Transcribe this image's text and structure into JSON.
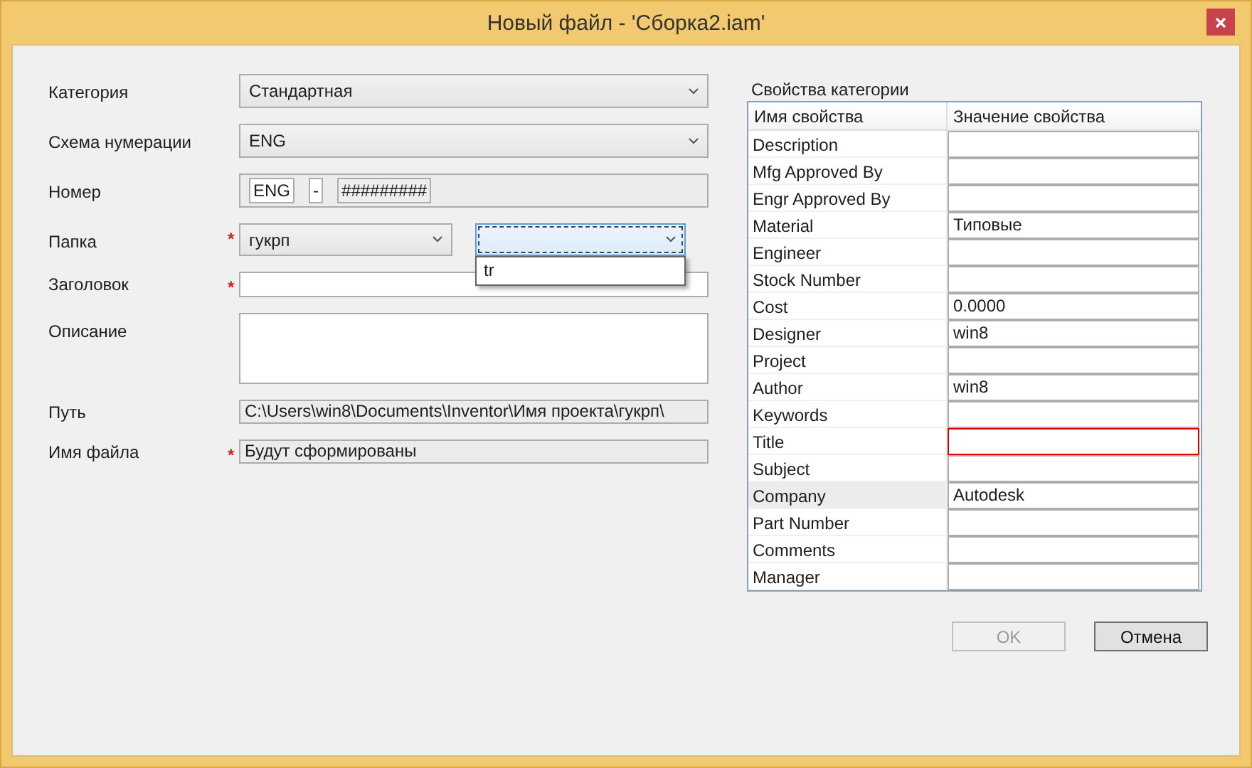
{
  "window": {
    "title": "Новый файл - 'Сборка2.iam'"
  },
  "form": [
    {
      "kind": "dropdown",
      "label": "Категория",
      "value": "Стандартная"
    },
    {
      "kind": "dropdown",
      "label": "Схема нумерации",
      "value": "ENG"
    },
    {
      "kind": "number",
      "label": "Номер",
      "parts": [
        "ENG",
        "-",
        "#########"
      ]
    },
    {
      "kind": "folder",
      "label": "Папка",
      "required_mark": "*",
      "value": "гукрп",
      "subfolder": {
        "focused": true,
        "expanded": true,
        "options": [
          "tr"
        ]
      }
    },
    {
      "kind": "text",
      "label": "Заголовок",
      "required_mark": "*"
    },
    {
      "kind": "textarea",
      "label": "Описание"
    },
    {
      "kind": "readonly",
      "label": "Путь",
      "value": "C:\\Users\\win8\\Documents\\Inventor\\Имя проекта\\гукрп\\"
    },
    {
      "kind": "readonly",
      "label": "Имя файла",
      "required_mark": "*",
      "value": "Будут сформированы"
    }
  ],
  "properties": {
    "title": "Свойства категории",
    "columns": [
      "Имя свойства",
      "Значение свойства"
    ],
    "rows": [
      {
        "name": "Description",
        "selected": false,
        "invalid": false
      },
      {
        "name": "Mfg Approved By",
        "selected": false,
        "invalid": false
      },
      {
        "name": "Engr Approved By",
        "selected": false,
        "invalid": false
      },
      {
        "name": "Material",
        "value": "Типовые",
        "selected": false,
        "invalid": false
      },
      {
        "name": "Engineer",
        "selected": false,
        "invalid": false
      },
      {
        "name": "Stock Number",
        "selected": false,
        "invalid": false
      },
      {
        "name": "Cost",
        "value": "0.0000",
        "selected": false,
        "invalid": false
      },
      {
        "name": "Designer",
        "value": "win8",
        "selected": false,
        "invalid": false
      },
      {
        "name": "Project",
        "selected": false,
        "invalid": false
      },
      {
        "name": "Author",
        "value": "win8",
        "selected": false,
        "invalid": false
      },
      {
        "name": "Keywords",
        "selected": false,
        "invalid": false
      },
      {
        "name": "Title",
        "selected": false,
        "invalid": true
      },
      {
        "name": "Subject",
        "selected": false,
        "invalid": false
      },
      {
        "name": "Company",
        "value": "Autodesk",
        "selected": true,
        "invalid": false
      },
      {
        "name": "Part Number",
        "selected": false,
        "invalid": false
      },
      {
        "name": "Comments",
        "selected": false,
        "invalid": false
      },
      {
        "name": "Manager",
        "selected": false,
        "invalid": false
      }
    ]
  },
  "buttons": [
    {
      "label": "OK",
      "disabled": true
    },
    {
      "label": "Отмена",
      "disabled": false
    }
  ]
}
